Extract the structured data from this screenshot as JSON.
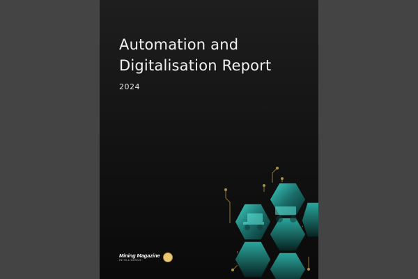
{
  "report": {
    "title_line1": "Automation and",
    "title_line2": "Digitalisation Report",
    "year": "2024"
  },
  "publisher": {
    "name": "Mining Magazine",
    "subtitle": "INTELLIGENCE"
  },
  "colors": {
    "background": "#444444",
    "cover": "#121212",
    "accent_teal": "#3fd3c6",
    "circuit_gold": "#c9a94d"
  },
  "icons": [
    "anniversary-badge-icon",
    "hexagon-image-tiles"
  ]
}
